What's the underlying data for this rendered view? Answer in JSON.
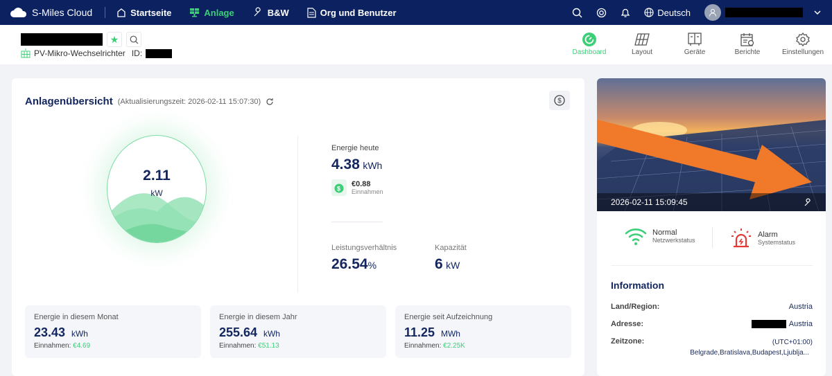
{
  "nav": {
    "brand": "S-Miles Cloud",
    "items": [
      {
        "label": "Startseite"
      },
      {
        "label": "Anlage"
      },
      {
        "label": "B&W"
      },
      {
        "label": "Org und Benutzer"
      }
    ],
    "language": "Deutsch"
  },
  "plant": {
    "type": "PV-Mikro-Wechselrichter",
    "id_label": "ID:"
  },
  "tabs": [
    {
      "label": "Dashboard"
    },
    {
      "label": "Layout"
    },
    {
      "label": "Geräte"
    },
    {
      "label": "Berichte"
    },
    {
      "label": "Einstellungen"
    }
  ],
  "overview": {
    "title": "Anlagenübersicht",
    "update": "(Aktualisierungszeit: 2026-02-11 15:07:30)",
    "power": "2.11",
    "power_unit": "kW",
    "today_label": "Energie heute",
    "today_value": "4.38",
    "today_unit": "kWh",
    "income_value": "€0.88",
    "income_label": "Einnahmen",
    "ratio_label": "Leistungsverhältnis",
    "ratio_value": "26.54",
    "ratio_unit": "%",
    "capacity_label": "Kapazität",
    "capacity_value": "6",
    "capacity_unit": "kW"
  },
  "stats": [
    {
      "label": "Energie in diesem Monat",
      "value": "23.43",
      "unit": "kWh",
      "income_label": "Einnahmen:",
      "income": "€4.69"
    },
    {
      "label": "Energie in diesem Jahr",
      "value": "255.64",
      "unit": "kWh",
      "income_label": "Einnahmen:",
      "income": "€51.13"
    },
    {
      "label": "Energie seit Aufzeichnung",
      "value": "11.25",
      "unit": "MWh",
      "income_label": "Einnahmen:",
      "income": "€2.25K"
    }
  ],
  "photo": {
    "timestamp": "2026-02-11 15:09:45"
  },
  "status": {
    "network_value": "Normal",
    "network_label": "Netzwerkstatus",
    "system_value": "Alarm",
    "system_label": "Systemstatus"
  },
  "info": {
    "title": "Information",
    "rows": [
      {
        "label": "Land/Region:",
        "value": "Austria"
      },
      {
        "label": "Adresse:",
        "value": "Austria"
      },
      {
        "label": "Zeitzone:",
        "value": "(UTC+01:00)",
        "value2": "Belgrade,Bratislava,Budapest,Ljublja..."
      }
    ]
  },
  "colors": {
    "navy": "#0b2160",
    "green": "#3ccf78",
    "alarm": "#e53935",
    "arrow": "#f07a2a"
  }
}
